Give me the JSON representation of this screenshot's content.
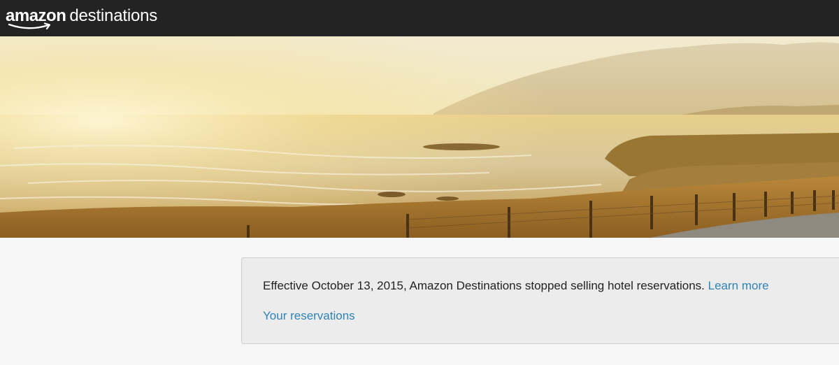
{
  "header": {
    "logo_brand": "amazon",
    "logo_product": "destinations",
    "background_color": "#232323"
  },
  "hero": {
    "description_icon": "coastal-landscape-image"
  },
  "notice": {
    "message": "Effective October 13, 2015, Amazon Destinations stopped selling hotel reservations.",
    "learn_more_label": "Learn more",
    "reservations_label": "Your reservations",
    "link_color": "#2f83b5"
  }
}
